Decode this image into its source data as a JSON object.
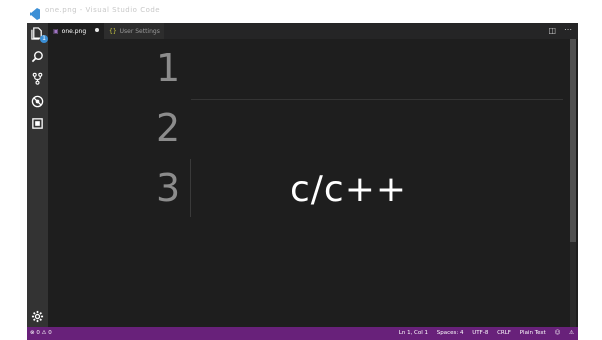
{
  "window": {
    "title": "one.png - Visual Studio Code"
  },
  "activity_bar": {
    "items": [
      {
        "name": "files",
        "icon": "files-icon",
        "badge": "1"
      },
      {
        "name": "search",
        "icon": "search-icon"
      },
      {
        "name": "git",
        "icon": "git-icon"
      },
      {
        "name": "debug",
        "icon": "debug-icon"
      },
      {
        "name": "extensions",
        "icon": "extensions-icon"
      }
    ],
    "settings_icon": "gear-icon"
  },
  "tabs": [
    {
      "label": "one.png",
      "active": true,
      "dirty": true
    },
    {
      "label": "User Settings",
      "active": false
    }
  ],
  "editor": {
    "line_numbers": [
      "1",
      "2",
      "3"
    ],
    "code_text": "c/c++"
  },
  "statusbar": {
    "left": {
      "errors": "0",
      "warnings": "0"
    },
    "right": {
      "position": "Ln 1, Col 1",
      "spaces": "Spaces: 4",
      "encoding": "UTF-8",
      "eol": "CRLF",
      "language": "Plain Text",
      "feedback_icon": "smiley-icon",
      "bell_icon": "bell-icon"
    }
  },
  "colors": {
    "statusbar": "#68217a",
    "activity_bar": "#333333",
    "editor_bg": "#1e1e1e"
  }
}
